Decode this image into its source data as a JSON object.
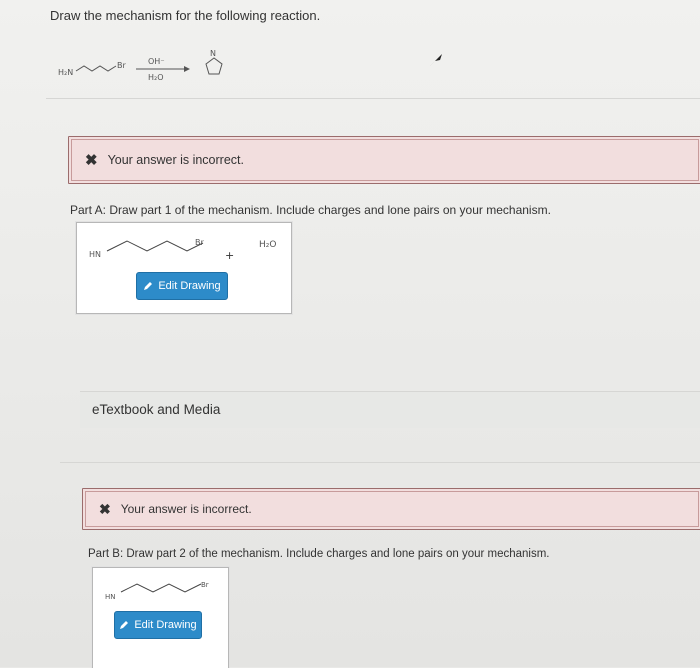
{
  "question": {
    "title": "Draw the mechanism for the following reaction."
  },
  "reaction": {
    "reactant_left": "H₂N",
    "reactant_right": "Br",
    "reagent_top": "OH⁻",
    "reagent_bottom": "H₂O",
    "product_atom": "N"
  },
  "feedback": {
    "incorrect_1": "Your answer is incorrect.",
    "incorrect_2": "Your answer is incorrect.",
    "x_mark": "✖"
  },
  "part_a": {
    "instruction": "Part A: Draw part 1 of the mechanism. Include charges and lone pairs on your mechanism.",
    "hn_label": "HN",
    "br_label": "Br",
    "plus": "+",
    "water": "H₂O",
    "edit_label": "Edit Drawing"
  },
  "etextbook": {
    "label": "eTextbook and Media"
  },
  "part_b": {
    "instruction": "Part B: Draw part 2 of the mechanism. Include charges and lone pairs on your mechanism.",
    "hn_label": "HN",
    "br_label": "Br",
    "edit_label": "Edit Drawing"
  },
  "icons": {
    "pencil": "pencil-icon",
    "cursor": "cursor-arrow-icon",
    "error": "error-x-icon"
  }
}
